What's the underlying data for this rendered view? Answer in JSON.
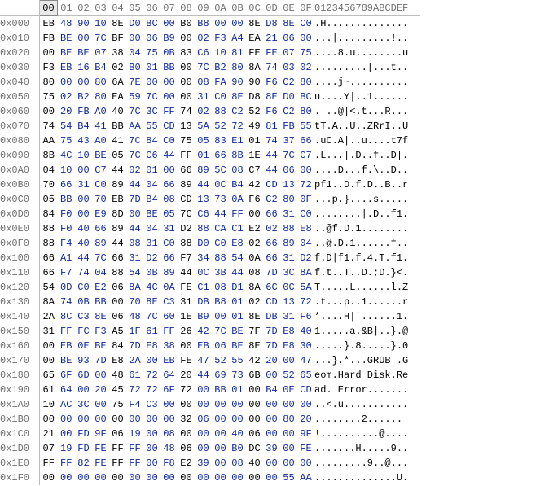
{
  "columns": [
    "00",
    "01",
    "02",
    "03",
    "04",
    "05",
    "06",
    "07",
    "08",
    "09",
    "0A",
    "0B",
    "0C",
    "0D",
    "0E",
    "0F"
  ],
  "ascii_header": "0123456789ABCDEF",
  "selected_col": 0,
  "rows": [
    {
      "addr": "0x000",
      "hex": [
        "EB",
        "48",
        "90",
        "10",
        "8E",
        "D0",
        "BC",
        "00",
        "B0",
        "B8",
        "00",
        "00",
        "8E",
        "D8",
        "8E",
        "C0"
      ],
      "asc": ".H.............."
    },
    {
      "addr": "0x010",
      "hex": [
        "FB",
        "BE",
        "00",
        "7C",
        "BF",
        "00",
        "06",
        "B9",
        "00",
        "02",
        "F3",
        "A4",
        "EA",
        "21",
        "06",
        "00"
      ],
      "asc": "...|.........!.."
    },
    {
      "addr": "0x020",
      "hex": [
        "00",
        "BE",
        "BE",
        "07",
        "38",
        "04",
        "75",
        "0B",
        "83",
        "C6",
        "10",
        "81",
        "FE",
        "FE",
        "07",
        "75"
      ],
      "asc": "....8.u........u"
    },
    {
      "addr": "0x030",
      "hex": [
        "F3",
        "EB",
        "16",
        "B4",
        "02",
        "B0",
        "01",
        "BB",
        "00",
        "7C",
        "B2",
        "80",
        "8A",
        "74",
        "03",
        "02"
      ],
      "asc": ".........|...t.."
    },
    {
      "addr": "0x040",
      "hex": [
        "80",
        "00",
        "00",
        "80",
        "6A",
        "7E",
        "00",
        "00",
        "00",
        "08",
        "FA",
        "90",
        "90",
        "F6",
        "C2",
        "80"
      ],
      "asc": "....j~.........."
    },
    {
      "addr": "0x050",
      "hex": [
        "75",
        "02",
        "B2",
        "80",
        "EA",
        "59",
        "7C",
        "00",
        "00",
        "31",
        "C0",
        "8E",
        "D8",
        "8E",
        "D0",
        "BC"
      ],
      "asc": "u....Y|..1......"
    },
    {
      "addr": "0x060",
      "hex": [
        "00",
        "20",
        "FB",
        "A0",
        "40",
        "7C",
        "3C",
        "FF",
        "74",
        "02",
        "88",
        "C2",
        "52",
        "F6",
        "C2",
        "80"
      ],
      "asc": ". ..@|<.t...R..."
    },
    {
      "addr": "0x070",
      "hex": [
        "74",
        "54",
        "B4",
        "41",
        "BB",
        "AA",
        "55",
        "CD",
        "13",
        "5A",
        "52",
        "72",
        "49",
        "81",
        "FB",
        "55"
      ],
      "asc": "tT.A..U..ZRrI..U"
    },
    {
      "addr": "0x080",
      "hex": [
        "AA",
        "75",
        "43",
        "A0",
        "41",
        "7C",
        "84",
        "C0",
        "75",
        "05",
        "83",
        "E1",
        "01",
        "74",
        "37",
        "66"
      ],
      "asc": ".uC.A|..u....t7f"
    },
    {
      "addr": "0x090",
      "hex": [
        "8B",
        "4C",
        "10",
        "BE",
        "05",
        "7C",
        "C6",
        "44",
        "FF",
        "01",
        "66",
        "8B",
        "1E",
        "44",
        "7C",
        "C7"
      ],
      "asc": ".L...|.D..f..D|."
    },
    {
      "addr": "0x0A0",
      "hex": [
        "04",
        "10",
        "00",
        "C7",
        "44",
        "02",
        "01",
        "00",
        "66",
        "89",
        "5C",
        "08",
        "C7",
        "44",
        "06",
        "00"
      ],
      "asc": "....D...f.\\..D.."
    },
    {
      "addr": "0x0B0",
      "hex": [
        "70",
        "66",
        "31",
        "C0",
        "89",
        "44",
        "04",
        "66",
        "89",
        "44",
        "0C",
        "B4",
        "42",
        "CD",
        "13",
        "72"
      ],
      "asc": "pf1..D.f.D..B..r"
    },
    {
      "addr": "0x0C0",
      "hex": [
        "05",
        "BB",
        "00",
        "70",
        "EB",
        "7D",
        "B4",
        "08",
        "CD",
        "13",
        "73",
        "0A",
        "F6",
        "C2",
        "80",
        "0F"
      ],
      "asc": "...p.}....s....."
    },
    {
      "addr": "0x0D0",
      "hex": [
        "84",
        "F0",
        "00",
        "E9",
        "8D",
        "00",
        "BE",
        "05",
        "7C",
        "C6",
        "44",
        "FF",
        "00",
        "66",
        "31",
        "C0"
      ],
      "asc": "........|.D..f1."
    },
    {
      "addr": "0x0E0",
      "hex": [
        "88",
        "F0",
        "40",
        "66",
        "89",
        "44",
        "04",
        "31",
        "D2",
        "88",
        "CA",
        "C1",
        "E2",
        "02",
        "88",
        "E8"
      ],
      "asc": "..@f.D.1........"
    },
    {
      "addr": "0x0F0",
      "hex": [
        "88",
        "F4",
        "40",
        "89",
        "44",
        "08",
        "31",
        "C0",
        "88",
        "D0",
        "C0",
        "E8",
        "02",
        "66",
        "89",
        "04"
      ],
      "asc": "..@.D.1......f.."
    },
    {
      "addr": "0x100",
      "hex": [
        "66",
        "A1",
        "44",
        "7C",
        "66",
        "31",
        "D2",
        "66",
        "F7",
        "34",
        "88",
        "54",
        "0A",
        "66",
        "31",
        "D2"
      ],
      "asc": "f.D|f1.f.4.T.f1."
    },
    {
      "addr": "0x110",
      "hex": [
        "66",
        "F7",
        "74",
        "04",
        "88",
        "54",
        "0B",
        "89",
        "44",
        "0C",
        "3B",
        "44",
        "08",
        "7D",
        "3C",
        "8A"
      ],
      "asc": "f.t..T..D.;D.}<."
    },
    {
      "addr": "0x120",
      "hex": [
        "54",
        "0D",
        "C0",
        "E2",
        "06",
        "8A",
        "4C",
        "0A",
        "FE",
        "C1",
        "08",
        "D1",
        "8A",
        "6C",
        "0C",
        "5A"
      ],
      "asc": "T.....L......l.Z"
    },
    {
      "addr": "0x130",
      "hex": [
        "8A",
        "74",
        "0B",
        "BB",
        "00",
        "70",
        "8E",
        "C3",
        "31",
        "DB",
        "B8",
        "01",
        "02",
        "CD",
        "13",
        "72"
      ],
      "asc": ".t...p..1......r"
    },
    {
      "addr": "0x140",
      "hex": [
        "2A",
        "8C",
        "C3",
        "8E",
        "06",
        "48",
        "7C",
        "60",
        "1E",
        "B9",
        "00",
        "01",
        "8E",
        "DB",
        "31",
        "F6"
      ],
      "asc": "*....H|`......1."
    },
    {
      "addr": "0x150",
      "hex": [
        "31",
        "FF",
        "FC",
        "F3",
        "A5",
        "1F",
        "61",
        "FF",
        "26",
        "42",
        "7C",
        "BE",
        "7F",
        "7D",
        "E8",
        "40"
      ],
      "asc": "1.....a.&B|..}.@"
    },
    {
      "addr": "0x160",
      "hex": [
        "00",
        "EB",
        "0E",
        "BE",
        "84",
        "7D",
        "E8",
        "38",
        "00",
        "EB",
        "06",
        "BE",
        "8E",
        "7D",
        "E8",
        "30"
      ],
      "asc": ".....}.8.....}.0"
    },
    {
      "addr": "0x170",
      "hex": [
        "00",
        "BE",
        "93",
        "7D",
        "E8",
        "2A",
        "00",
        "EB",
        "FE",
        "47",
        "52",
        "55",
        "42",
        "20",
        "00",
        "47"
      ],
      "asc": "...}.*...GRUB .G"
    },
    {
      "addr": "0x180",
      "hex": [
        "65",
        "6F",
        "6D",
        "00",
        "48",
        "61",
        "72",
        "64",
        "20",
        "44",
        "69",
        "73",
        "6B",
        "00",
        "52",
        "65"
      ],
      "asc": "eom.Hard Disk.Re"
    },
    {
      "addr": "0x190",
      "hex": [
        "61",
        "64",
        "00",
        "20",
        "45",
        "72",
        "72",
        "6F",
        "72",
        "00",
        "BB",
        "01",
        "00",
        "B4",
        "0E",
        "CD"
      ],
      "asc": "ad. Error......."
    },
    {
      "addr": "0x1A0",
      "hex": [
        "10",
        "AC",
        "3C",
        "00",
        "75",
        "F4",
        "C3",
        "00",
        "00",
        "00",
        "00",
        "00",
        "00",
        "00",
        "00",
        "00"
      ],
      "asc": "..<.u..........."
    },
    {
      "addr": "0x1B0",
      "hex": [
        "00",
        "00",
        "00",
        "00",
        "00",
        "00",
        "00",
        "00",
        "32",
        "06",
        "00",
        "00",
        "00",
        "00",
        "80",
        "20"
      ],
      "asc": "........2...... "
    },
    {
      "addr": "0x1C0",
      "hex": [
        "21",
        "00",
        "FD",
        "9F",
        "06",
        "19",
        "00",
        "08",
        "00",
        "00",
        "00",
        "40",
        "06",
        "00",
        "00",
        "9F"
      ],
      "asc": "!..........@...."
    },
    {
      "addr": "0x1D0",
      "hex": [
        "07",
        "19",
        "FD",
        "FE",
        "FF",
        "FF",
        "00",
        "48",
        "06",
        "00",
        "00",
        "B0",
        "DC",
        "39",
        "00",
        "FE"
      ],
      "asc": ".......H.....9.."
    },
    {
      "addr": "0x1E0",
      "hex": [
        "FF",
        "FF",
        "82",
        "FE",
        "FF",
        "FF",
        "00",
        "F8",
        "E2",
        "39",
        "00",
        "08",
        "40",
        "00",
        "00",
        "00"
      ],
      "asc": ".........9..@..."
    },
    {
      "addr": "0x1F0",
      "hex": [
        "00",
        "00",
        "00",
        "00",
        "00",
        "00",
        "00",
        "00",
        "00",
        "00",
        "00",
        "00",
        "00",
        "00",
        "55",
        "AA"
      ],
      "asc": "..............U."
    }
  ],
  "black_cols": [
    0,
    4,
    8,
    12
  ]
}
